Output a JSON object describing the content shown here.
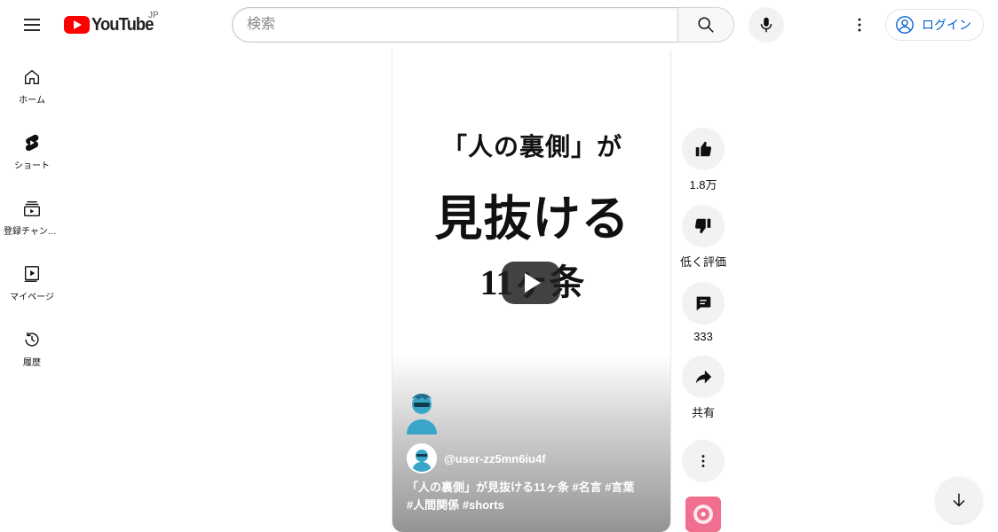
{
  "header": {
    "logo_text": "YouTube",
    "country_code": "JP",
    "search_placeholder": "検索",
    "login_label": "ログイン"
  },
  "guide": {
    "items": [
      {
        "label": "ホーム",
        "icon": "home-icon"
      },
      {
        "label": "ショート",
        "icon": "shorts-icon"
      },
      {
        "label": "登録チャンネル",
        "icon": "subscriptions-icon"
      },
      {
        "label": "マイページ",
        "icon": "library-icon"
      },
      {
        "label": "履歴",
        "icon": "history-icon"
      }
    ]
  },
  "video": {
    "overlay_line1": "「人の裏側」が",
    "overlay_line2": "見抜ける",
    "overlay_line3": "11ヶ条",
    "channel_handle": "@user-zz5mn6iu4f",
    "caption_line1": "「人の裏側」が見抜ける11ヶ条 #名言 #言葉",
    "caption_line2": "#人間関係 #shorts"
  },
  "actions": {
    "like_count": "1.8万",
    "dislike_label": "低く評価",
    "comment_count": "333",
    "share_label": "共有"
  },
  "colors": {
    "brand_red": "#ff0000",
    "link_blue": "#065fd4",
    "button_bg": "#f2f2f2"
  }
}
